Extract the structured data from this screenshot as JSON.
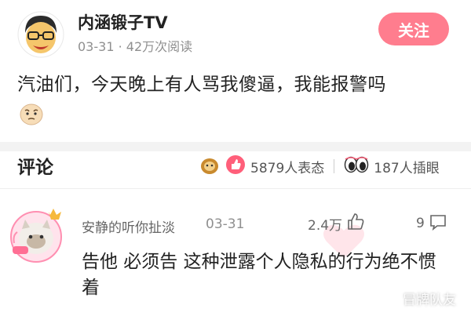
{
  "post": {
    "author": "内涵锻子TV",
    "date": "03-31",
    "separator": "·",
    "views": "42万次阅读",
    "follow_label": "关注",
    "text": "汽油们，今天晚上有人骂我傻逼，我能报警吗"
  },
  "comments_section": {
    "title": "评论",
    "reactions_count": "5879人表态",
    "eyes_count": "187人插眼"
  },
  "comment": {
    "user": "安静的听你扯淡",
    "date": "03-31",
    "likes": "2.4万",
    "replies": "9",
    "text": "告他  必须告  这种泄露个人隐私的行为绝不惯着"
  },
  "watermark": "冒牌队友",
  "colors": {
    "follow_bg": "#ff7d8e",
    "accent_pink": "#ff5f7a",
    "divider": "#f3f3f3"
  }
}
